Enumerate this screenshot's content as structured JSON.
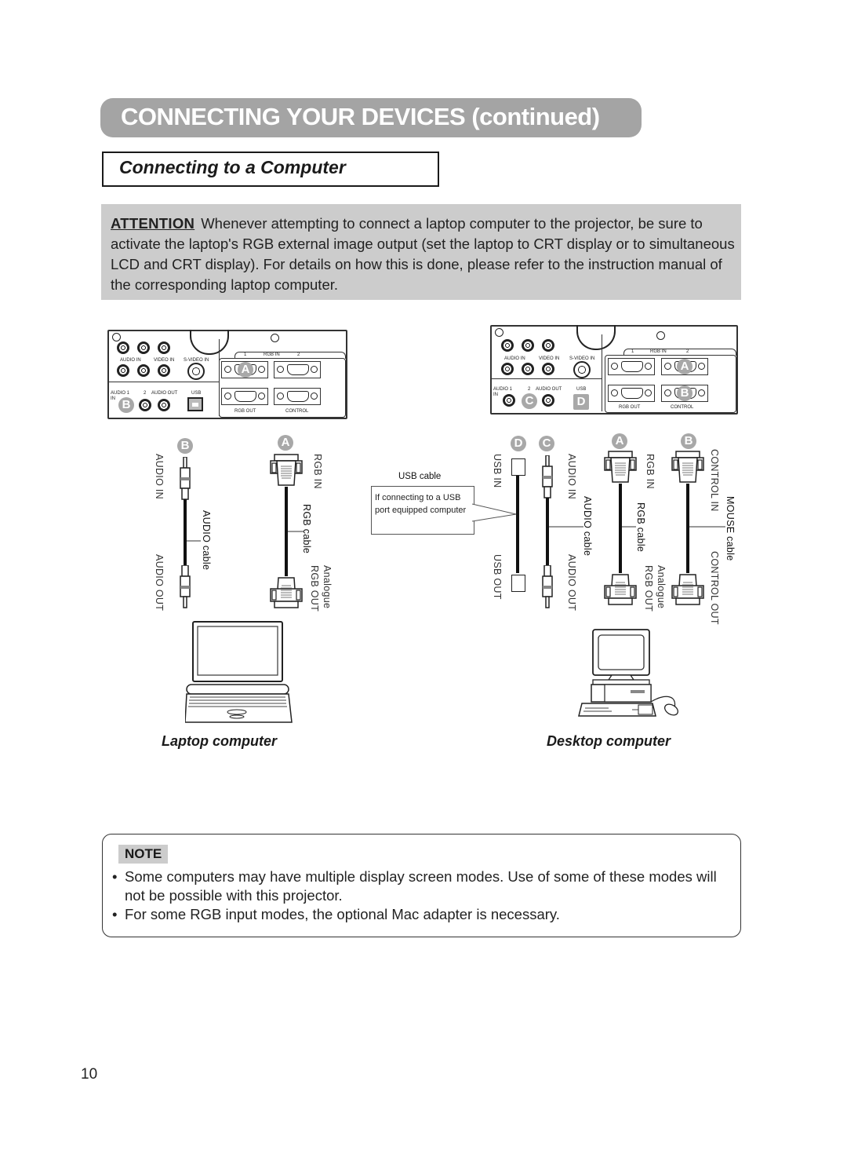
{
  "header": {
    "title": "CONNECTING YOUR DEVICES (continued)",
    "subtitle": "Connecting to a Computer",
    "bar_color": "#a4a4a4"
  },
  "attention": {
    "label": "ATTENTION",
    "text": "Whenever attempting to connect a laptop computer to the projector, be sure to activate the laptop's RGB external image output (set the laptop to CRT display or to simultaneous LCD and CRT display). For details on how this is done, please refer to the instruction manual of the corresponding laptop computer.",
    "background": "#cccccc"
  },
  "projector_panel": {
    "labels": {
      "audio_in": "AUDIO IN",
      "video_in": "VIDEO IN",
      "s_video_in": "S-VIDEO IN",
      "audio_1": "AUDIO 1",
      "in": "IN",
      "audio_2": "2",
      "audio_out": "AUDIO OUT",
      "usb": "USB",
      "rgb_in": "RGB   IN",
      "rgb_in_1": "1",
      "rgb_in_2": "2",
      "rgb_out": "RGB  OUT",
      "control": "CONTROL"
    }
  },
  "laptop_diagram": {
    "caption": "Laptop computer",
    "audio_cable": {
      "badge": "B",
      "top_label": "AUDIO IN",
      "bottom_label": "AUDIO OUT",
      "cable_name": "AUDIO cable"
    },
    "rgb_cable": {
      "badge": "A",
      "top_label": "RGB IN",
      "bottom_label": "Analogue RGB OUT",
      "bottom_label_line1": "Analogue",
      "bottom_label_line2": "RGB OUT",
      "cable_name": "RGB cable"
    },
    "panel_badges": [
      "A",
      "B"
    ]
  },
  "desktop_diagram": {
    "caption": "Desktop computer",
    "usb_cable": {
      "badge": "D",
      "top_label": "USB IN",
      "bottom_label": "USB OUT",
      "cable_name": "USB cable",
      "callout": "If connecting to a USB port equipped computer"
    },
    "audio_cable": {
      "badge": "C",
      "top_label": "AUDIO IN",
      "bottom_label": "AUDIO OUT",
      "cable_name": "AUDIO cable"
    },
    "rgb_cable": {
      "badge": "A",
      "top_label": "RGB IN",
      "bottom_label_line1": "Analogue",
      "bottom_label_line2": "RGB OUT",
      "cable_name": "RGB cable"
    },
    "mouse_cable": {
      "badge": "B",
      "top_label": "CONTROL IN",
      "bottom_label": "CONTROL OUT",
      "cable_name": "MOUSE cable"
    },
    "panel_badges": [
      "A",
      "B",
      "C",
      "D"
    ]
  },
  "note": {
    "label": "NOTE",
    "items": [
      "Some computers may have multiple display screen modes. Use of some of these modes will not be possible with this projector.",
      "For some RGB input modes, the optional Mac adapter is necessary."
    ]
  },
  "page_number": "10"
}
